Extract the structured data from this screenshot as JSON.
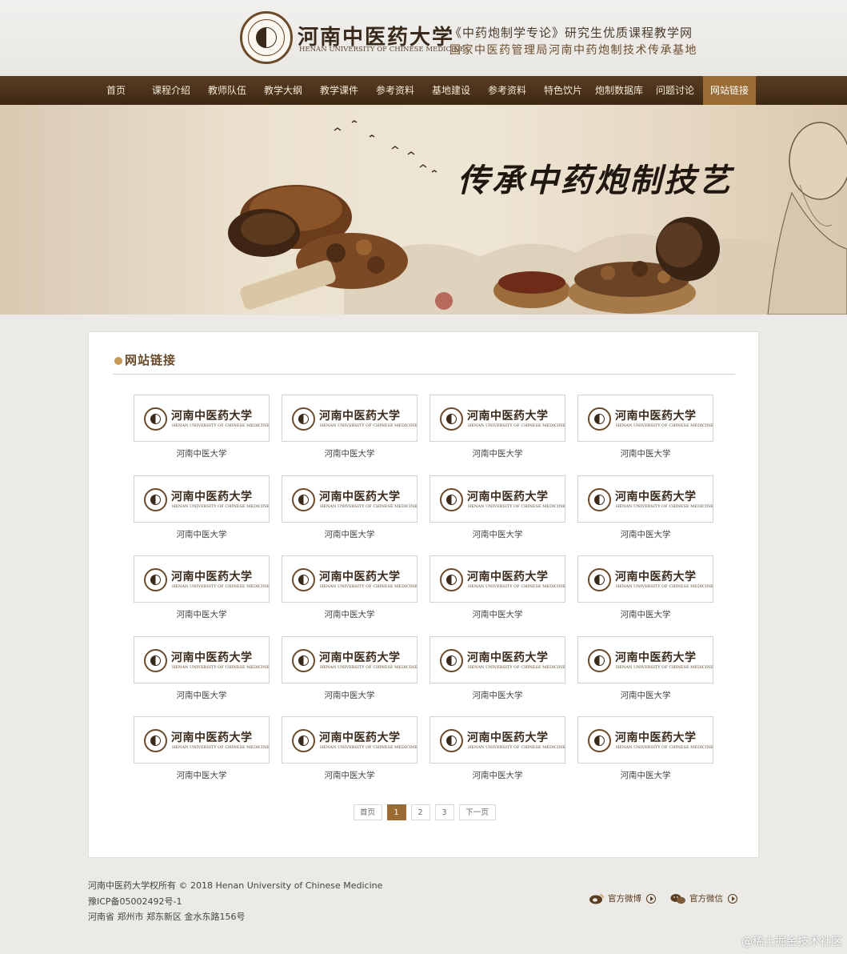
{
  "header": {
    "site_name": "河南中医药大学",
    "site_name_en": "HENAN UNIVERSITY OF CHINESE MEDICINE",
    "subtitle_line1": "《中药炮制学专论》研究生优质课程教学网",
    "subtitle_line2": "国家中医药管理局河南中药炮制技术传承基地"
  },
  "nav": {
    "items": [
      {
        "label": "首页"
      },
      {
        "label": "课程介绍"
      },
      {
        "label": "教师队伍"
      },
      {
        "label": "教学大纲"
      },
      {
        "label": "教学课件"
      },
      {
        "label": "参考资料"
      },
      {
        "label": "基地建设"
      },
      {
        "label": "参考资料"
      },
      {
        "label": "特色饮片"
      },
      {
        "label": "炮制数据库"
      },
      {
        "label": "问题讨论"
      },
      {
        "label": "网站链接"
      }
    ],
    "active_index": 11
  },
  "banner": {
    "slogan": "传承中药炮制技艺"
  },
  "links_section": {
    "title": "网站链接",
    "tile_logo_name": "河南中医药大学",
    "tile_logo_en": "HENAN UNIVERSITY OF CHINESE MEDICINE",
    "tiles": [
      "河南中医大学",
      "河南中医大学",
      "河南中医大学",
      "河南中医大学",
      "河南中医大学",
      "河南中医大学",
      "河南中医大学",
      "河南中医大学",
      "河南中医大学",
      "河南中医大学",
      "河南中医大学",
      "河南中医大学",
      "河南中医大学",
      "河南中医大学",
      "河南中医大学",
      "河南中医大学",
      "河南中医大学",
      "河南中医大学",
      "河南中医大学",
      "河南中医大学"
    ]
  },
  "pagination": {
    "first": "首页",
    "pages": [
      "1",
      "2",
      "3"
    ],
    "current": "1",
    "next": "下一页"
  },
  "footer": {
    "copyright": "河南中医药大学权所有 © 2018 Henan University of Chinese Medicine",
    "icp": "豫ICP备05002492号-1",
    "address": "河南省 郑州市 郑东新区 金水东路156号",
    "weibo_label": "官方微博",
    "wechat_label": "官方微信"
  },
  "watermark": "@稀土掘金技术社区",
  "colors": {
    "nav_bg": "#4a321b",
    "accent": "#9a6c34",
    "text_dark": "#3a2a1c"
  }
}
